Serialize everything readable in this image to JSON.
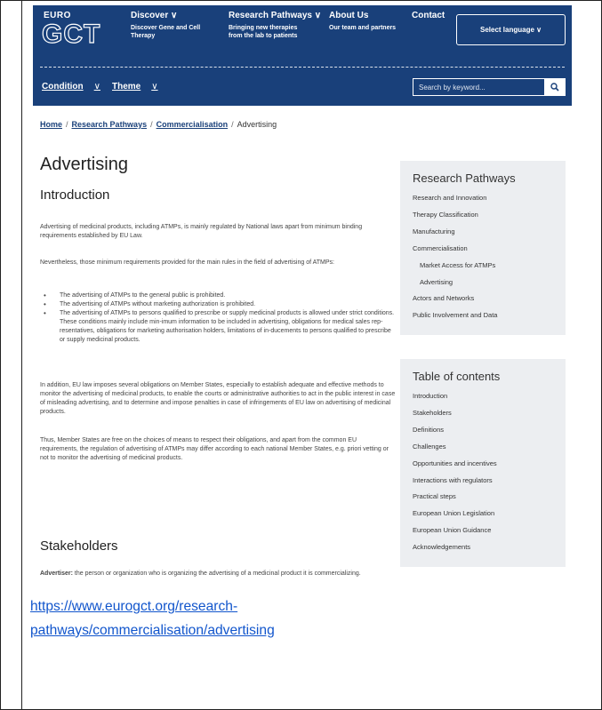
{
  "header": {
    "logo_small": "EURO",
    "logo_big": "GCT",
    "nav": [
      {
        "title": "Discover ∨",
        "sub": [
          "Discover Gene and Cell",
          "Therapy"
        ]
      },
      {
        "title": "Research Pathways ∨",
        "sub": [
          "Bringing new therapies",
          "from the lab to patients"
        ]
      },
      {
        "title": "About Us",
        "sub": [
          "Our team and partners"
        ]
      },
      {
        "title": "Contact",
        "sub": []
      }
    ],
    "language_button": "Select language ∨",
    "filters": [
      {
        "label": "Condition",
        "chevron": "∨"
      },
      {
        "label": "Theme",
        "chevron": "∨"
      }
    ],
    "search_placeholder": "Search by keyword..."
  },
  "breadcrumb": {
    "items": [
      "Home",
      "Research Pathways",
      "Commercialisation"
    ],
    "current": "Advertising",
    "separator": "/"
  },
  "main": {
    "title": "Advertising",
    "intro_heading": "Introduction",
    "p1": "Advertising of medicinal products, including ATMPs, is mainly regulated by National laws apart from minimum binding requirements established by EU Law.",
    "p2": "Nevertheless, those minimum requirements provided for the main rules in the field of advertising of ATMPs:",
    "bullets": [
      "The advertising of ATMPs to the general public is prohibited.",
      "The advertising of ATMPs without marketing authorization is prohibited.",
      "The advertising of ATMPs to persons qualified to prescribe or supply medicinal products is allowed under strict conditions. These conditions mainly include min-imum information to be included in advertising, obligations for medical sales rep-resentatives, obligations for marketing authorisation holders, limitations of in-ducements to persons qualified to prescribe or supply medicinal products."
    ],
    "p3": "In addition, EU law imposes several obligations on Member States, especially to establish adequate and effective methods to monitor the advertising of medicinal products, to enable the courts or administrative authorities to act in the public interest in case of misleading advertising, and to determine and impose penalties in case of infringements of EU law on advertising of medicinal products.",
    "p4": "Thus, Member States are free on the choices of means to respect their obligations, and apart from the common EU requirements, the regulation of advertising of ATMPs may differ according to each national Member States, e.g. priori vetting or not to monitor the advertising of medicinal products.",
    "stakeholders_heading": "Stakeholders",
    "advertiser_term": "Advertiser:",
    "advertiser_def": " the person or organization who is organizing the advertising of a medicinal product it is commercializing."
  },
  "sidebar_pathways": {
    "title": "Research Pathways",
    "items": [
      {
        "label": "Research and Innovation",
        "sub": false
      },
      {
        "label": "Therapy Classification",
        "sub": false
      },
      {
        "label": "Manufacturing",
        "sub": false
      },
      {
        "label": "Commercialisation",
        "sub": false
      },
      {
        "label": "Market Access for ATMPs",
        "sub": true
      },
      {
        "label": "Advertising",
        "sub": true
      },
      {
        "label": "Actors and Networks",
        "sub": false
      },
      {
        "label": "Public Involvement and Data",
        "sub": false
      }
    ]
  },
  "sidebar_toc": {
    "title": "Table of contents",
    "items": [
      "Introduction",
      "Stakeholders",
      "Definitions",
      "Challenges",
      "Opportunities and incentives",
      "Interactions with regulators",
      "Practical steps",
      "European Union Legislation",
      "European Union Guidance",
      "Acknowledgements"
    ]
  },
  "url": {
    "line1": "https://www.eurogct.org/research-",
    "line2": "pathways/commercialisation/advertising"
  },
  "colors": {
    "brand_navy": "#19407a",
    "sidebar_bg": "#eceef1",
    "link_blue": "#1155cc"
  }
}
